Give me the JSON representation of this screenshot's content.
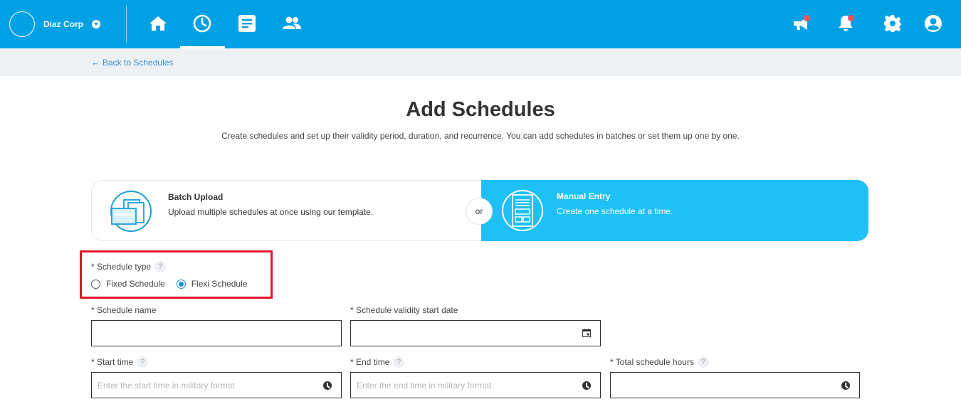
{
  "nav": {
    "company_name": "Diaz Corp"
  },
  "subheader": {
    "back_label": "Back to Schedules"
  },
  "page": {
    "title": "Add Schedules",
    "description": "Create schedules and set up their validity period, duration, and recurrence. You can add schedules in batches or set them up one by one."
  },
  "options": {
    "batch_title": "Batch Upload",
    "batch_sub": "Upload multiple schedules at once using our template.",
    "or_label": "or",
    "manual_title": "Manual Entry",
    "manual_sub": "Create one schedule at a time."
  },
  "form": {
    "schedule_type_label": "* Schedule type",
    "fixed_label": "Fixed Schedule",
    "flexi_label": "Flexi Schedule",
    "selected_type": "Flexi Schedule",
    "schedule_name_label": "* Schedule name",
    "schedule_name_value": "",
    "validity_label": "* Schedule validity start date",
    "validity_value": "",
    "start_time_label": "* Start time",
    "start_time_placeholder": "Enter the start time in military format",
    "end_time_label": "* End time",
    "end_time_placeholder": "Enter the end time in military format",
    "total_hours_label": "* Total schedule hours",
    "total_hours_placeholder": "",
    "help_glyph": "?"
  },
  "colors": {
    "nav_bg": "#00a1e4",
    "manual_card_bg": "#1ec0f5",
    "highlight": "#e0172a",
    "badge": "#f0545b"
  }
}
